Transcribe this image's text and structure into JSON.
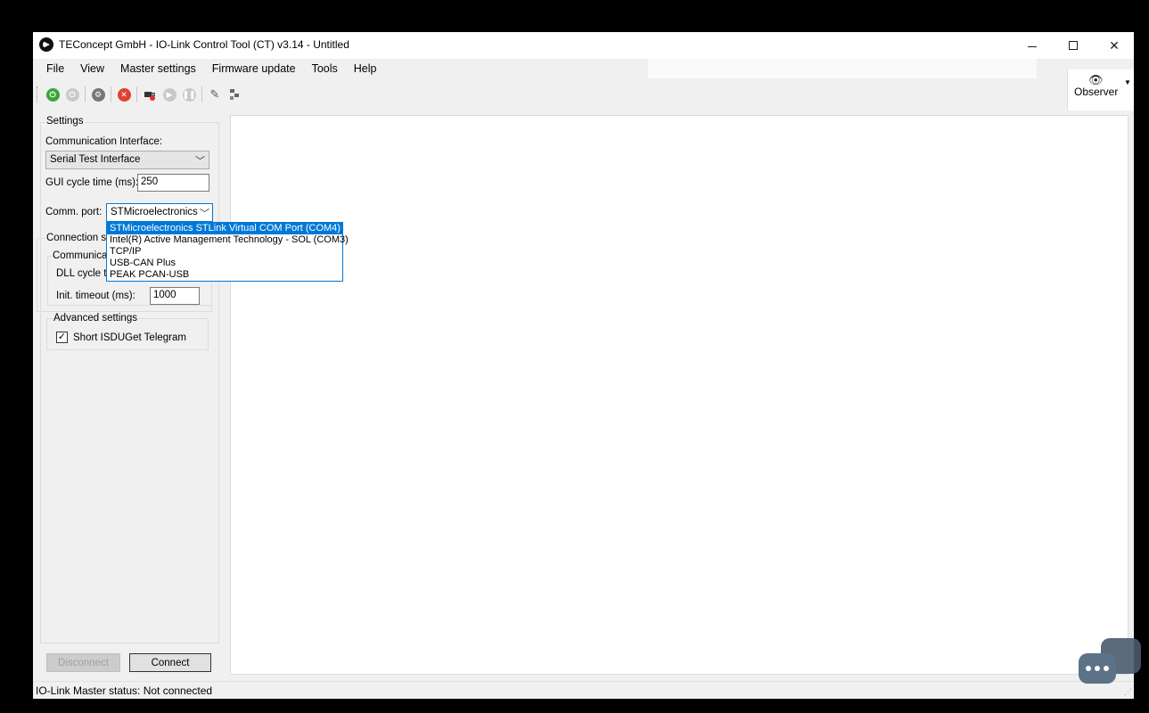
{
  "window": {
    "title": "TEConcept GmbH - IO-Link Control Tool (CT) v3.14 - Untitled",
    "controls": {
      "minimize": "minimize",
      "maximize": "maximize",
      "close": "✕"
    }
  },
  "menu": [
    "File",
    "View",
    "Master settings",
    "Firmware update",
    "Tools",
    "Help"
  ],
  "toolbar": {
    "icons": [
      "power-on-icon",
      "power-off-icon",
      "gear-icon",
      "stop-icon",
      "disconnect-plug-icon",
      "play-icon",
      "pause-icon",
      "wrench-icon",
      "network-icon"
    ]
  },
  "observer": {
    "label": "Observer",
    "icon": "eye-icon"
  },
  "settings": {
    "legend": "Settings",
    "comm_interface_label": "Communication Interface:",
    "comm_interface_value": "Serial Test Interface",
    "gui_cycle_label": "GUI cycle time (ms):",
    "gui_cycle_value": "250",
    "comm_port_label": "Comm. port:",
    "comm_port_value": "STMicroelectronics S",
    "connection_legend": "Connection se",
    "communication_legend": "Communicati",
    "dll_cycle_label": "DLL cycle ti",
    "init_timeout_label": "Init. timeout (ms):",
    "init_timeout_value": "1000",
    "advanced_legend": "Advanced settings",
    "short_isdu_label": "Short ISDUGet Telegram",
    "short_isdu_checked": true
  },
  "comm_port_options": [
    "STMicroelectronics STLink Virtual COM Port (COM4)",
    "Intel(R) Active Management Technology - SOL (COM3)",
    "TCP/IP",
    "USB-CAN Plus",
    "PEAK PCAN-USB"
  ],
  "buttons": {
    "disconnect": "Disconnect",
    "connect": "Connect"
  },
  "status": {
    "text": "IO-Link Master status:  Not connected"
  }
}
